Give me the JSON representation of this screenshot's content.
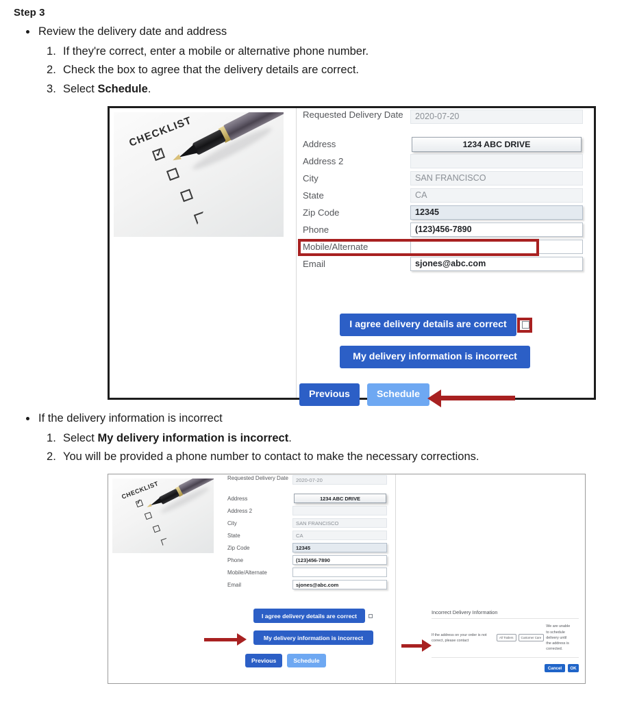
{
  "doc": {
    "step_title": "Step 3",
    "bullet1": "Review the delivery date and address",
    "b1_items": [
      "If they're correct, enter a mobile or alternative phone number.",
      "Check the box to agree that the delivery details are correct.",
      "Select Schedule."
    ],
    "b1_item3_prefix": "Select ",
    "b1_item3_bold": "Schedule",
    "b1_item3_suffix": ".",
    "bullet2": "If the delivery information is incorrect",
    "b2_item1_prefix": "Select ",
    "b2_item1_bold": "My delivery information is incorrect",
    "b2_item1_suffix": ".",
    "b2_item2": "You will be provided a phone number to contact to make the necessary corrections."
  },
  "photo": {
    "caption": "CHECKLIST",
    "check_mark": "✓"
  },
  "form": {
    "fields": [
      {
        "label": "Requested Delivery Date",
        "value": "2020-07-20",
        "style": "plain"
      },
      {
        "label": "Address",
        "value": "1234 ABC DRIVE",
        "style": "addrbtn"
      },
      {
        "label": "Address 2",
        "value": "",
        "style": "plain"
      },
      {
        "label": "City",
        "value": "SAN FRANCISCO",
        "style": "plain"
      },
      {
        "label": "State",
        "value": "CA",
        "style": "plain"
      },
      {
        "label": "Zip Code",
        "value": "12345",
        "style": "filled"
      },
      {
        "label": "Phone",
        "value": "(123)456-7890",
        "style": "white"
      },
      {
        "label": "Mobile/Alternate",
        "value": "",
        "style": "empty"
      },
      {
        "label": "Email",
        "value": "sjones@abc.com",
        "style": "white"
      }
    ]
  },
  "actions": {
    "agree_label": "I agree delivery details are correct",
    "incorrect_label": "My delivery information is incorrect",
    "previous_label": "Previous",
    "schedule_label": "Schedule"
  },
  "dialog": {
    "title": "Incorrect Delivery Information",
    "text_before": "If the address on your order is not correct, please contact",
    "pill1": "All Trailers",
    "pill2": "Customer Care",
    "text_after": "We are unable to schedule delivery until the address is corrected.",
    "cancel_label": "Cancel",
    "ok_label": "OK"
  },
  "colors": {
    "annotation_red": "#a82121",
    "primary_blue": "#2c5fc6",
    "disabled_blue": "#6ea8f2",
    "dialog_blue": "#1f64c8"
  }
}
